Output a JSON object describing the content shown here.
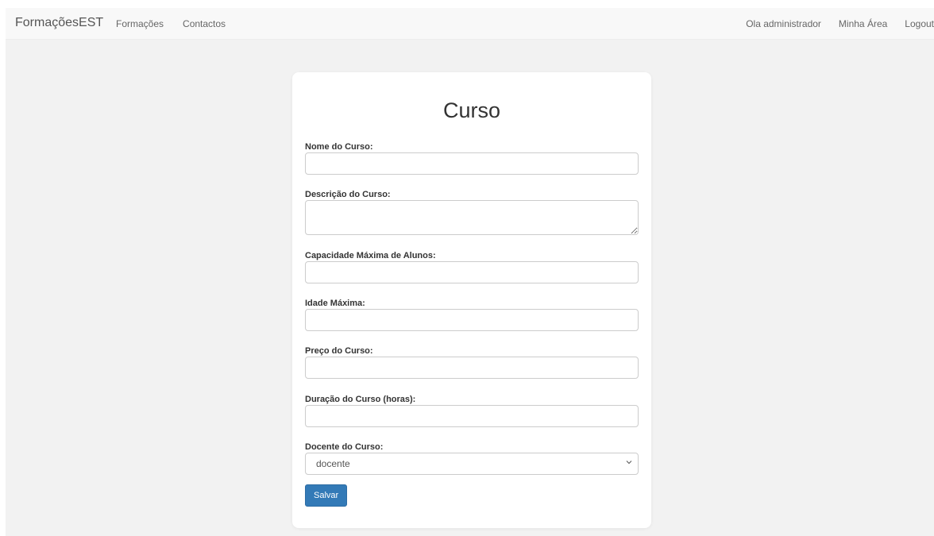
{
  "navbar": {
    "brand": "FormaçõesEST",
    "left_links": [
      "Formações",
      "Contactos"
    ],
    "greeting": "Ola administrador",
    "my_area": "Minha Área",
    "logout": "Logout"
  },
  "form": {
    "title": "Curso",
    "fields": {
      "nome": {
        "label": "Nome do Curso:",
        "value": ""
      },
      "descricao": {
        "label": "Descrição do Curso:",
        "value": ""
      },
      "capacidade": {
        "label": "Capacidade Máxima de Alunos:",
        "value": ""
      },
      "idade": {
        "label": "Idade Máxima:",
        "value": ""
      },
      "preco": {
        "label": "Preço do Curso:",
        "value": ""
      },
      "duracao": {
        "label": "Duração do Curso (horas):",
        "value": ""
      },
      "docente": {
        "label": "Docente do Curso:",
        "selected": "docente"
      }
    },
    "submit_label": "Salvar"
  },
  "colors": {
    "page_background": "#f2f2f2",
    "navbar_background": "#f8f8f8",
    "button_primary": "#337ab7"
  },
  "icons": {
    "select_arrow": "chevron-down-icon"
  }
}
